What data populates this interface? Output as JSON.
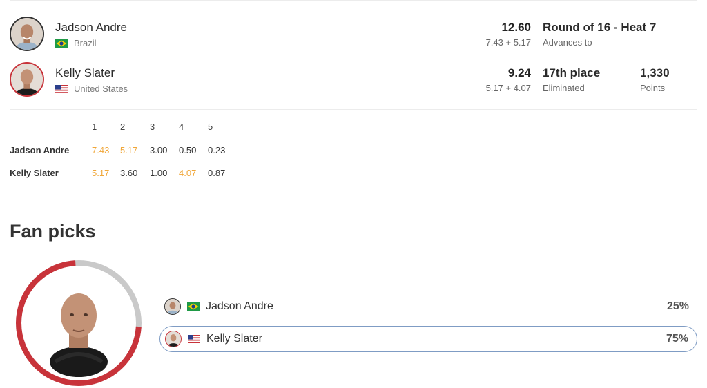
{
  "colors": {
    "highlight": "#f0a73a",
    "accent_red": "#c8333a",
    "track_gray": "#c9c9c9",
    "pick_border": "#7f9cc4"
  },
  "athletes": [
    {
      "name": "Jadson Andre",
      "country": "Brazil",
      "flag_icon": "brazil-flag-icon",
      "total": "12.60",
      "breakdown": "7.43 + 5.17",
      "result": "Round of 16 - Heat 7",
      "result_sub": "Advances to"
    },
    {
      "name": "Kelly Slater",
      "country": "United States",
      "flag_icon": "usa-flag-icon",
      "total": "9.24",
      "breakdown": "5.17 + 4.07",
      "result": "17th place",
      "result_sub": "Eliminated",
      "points": "1,330",
      "points_label": "Points"
    }
  ],
  "waves": {
    "headers": [
      "1",
      "2",
      "3",
      "4",
      "5"
    ],
    "rows": [
      {
        "name": "Jadson Andre",
        "scores": [
          "7.43",
          "5.17",
          "3.00",
          "0.50",
          "0.23"
        ],
        "counted": [
          true,
          true,
          false,
          false,
          false
        ]
      },
      {
        "name": "Kelly Slater",
        "scores": [
          "5.17",
          "3.60",
          "1.00",
          "4.07",
          "0.87"
        ],
        "counted": [
          true,
          false,
          false,
          true,
          false
        ]
      }
    ]
  },
  "fan_picks": {
    "title": "Fan picks",
    "donut_share": 0.75,
    "picks": [
      {
        "name": "Jadson Andre",
        "percent": "25%",
        "share": 0.25,
        "selected": false
      },
      {
        "name": "Kelly Slater",
        "percent": "75%",
        "share": 0.75,
        "selected": true
      }
    ]
  }
}
